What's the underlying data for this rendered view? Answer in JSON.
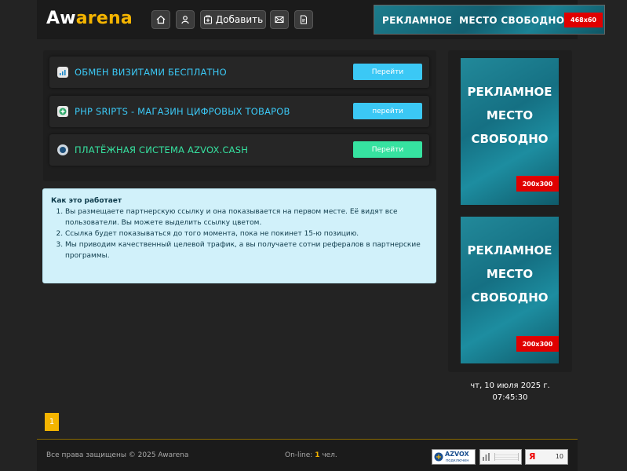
{
  "header": {
    "logo": {
      "part1": "Aw",
      "part2": "arena"
    },
    "nav": {
      "add_label": "Добавить",
      "icons": [
        "home-icon",
        "user-icon",
        "add-icon",
        "mail-icon",
        "document-icon"
      ]
    },
    "banner": {
      "text": "РЕКЛАМНОЕ  МЕСТО СВОБОДНО",
      "size": "468x60"
    }
  },
  "links": [
    {
      "label": "ОБМЕН ВИЗИТАМИ БЕСПЛАТНО",
      "button": "Перейти",
      "icon": "signal-icon",
      "color": "#3bc8f5"
    },
    {
      "label": "PHP SRIPTS - МАГАЗИН ЦИФРОВЫХ ТОВАРОВ",
      "button": "перейти",
      "icon": "plus-icon",
      "color": "#3bc8f5"
    },
    {
      "label": "ПЛАТЁЖНАЯ СИСТЕМА AZVOX.CASH",
      "button": "Перейти",
      "icon": "circle-icon",
      "color": "#36e2a0"
    }
  ],
  "info": {
    "title": "Как это работает",
    "items": [
      "Вы размещаете партнерскую ссылку и она показывается на первом месте. Её видят все пользователи. Вы можете выделить ссылку цветом.",
      "Ссылка будет показываться до того момента, пока не покинет 15-ю позицию.",
      "Мы приводим качественный целевой трафик, а вы получаете сотни рефералов в партнерские программы."
    ]
  },
  "side_ads": [
    {
      "line1": "РЕКЛАМНОЕ",
      "line2": "МЕСТО",
      "line3": "СВОБОДНО",
      "size": "200x300"
    },
    {
      "line1": "РЕКЛАМНОЕ",
      "line2": "МЕСТО",
      "line3": "СВОБОДНО",
      "size": "200x300"
    }
  ],
  "datetime": {
    "date": "чт, 10 июля 2025 г.",
    "time": "07:45:30"
  },
  "pagination": {
    "current": "1"
  },
  "footer": {
    "copyright": "Все права защищены © 2025 Awarena",
    "online_prefix": "On-line:",
    "online_count": "1",
    "online_suffix": "чел.",
    "azvox_label": "AZVOX",
    "azvox_sub": "подключен",
    "yandex_letter": "Я",
    "yandex_count": "10"
  },
  "colors": {
    "accent": "#f4b400",
    "cyan": "#3bc8f5",
    "green": "#36e2a0",
    "ad_red": "#e00000"
  }
}
